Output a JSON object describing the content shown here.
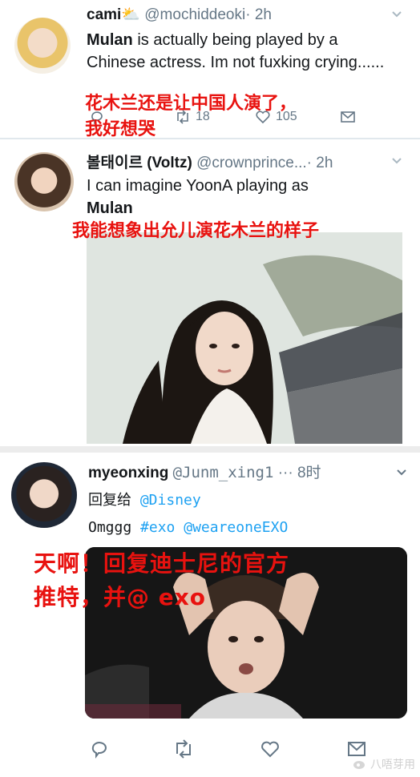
{
  "tweets": [
    {
      "display_name": "cami",
      "handle": "@mochiddeoki",
      "time": "· 2h",
      "text_bold": "Mulan",
      "text_rest": " is actually being played by a Chinese actress. Im not fuxking crying......",
      "retweets": "18",
      "likes": "105",
      "annotation_line1": "花木兰还是让中国人演了，",
      "annotation_line2": "我好想哭"
    },
    {
      "display_name": "볼태이르 (Voltz)",
      "handle": "@crownprince...",
      "time": "· 2h",
      "text_line1": "I can imagine YoonA playing as",
      "text_bold": "Mulan",
      "annotation": "我能想象出允儿演花木兰的样子"
    },
    {
      "display_name": "myeonxing",
      "handle": "@Junm_xing1",
      "more": "···",
      "time": "8时",
      "reply_prefix": "回复给",
      "reply_to": "@Disney",
      "text_start": "Omggg",
      "hashtag": "#exo",
      "mention": "@weareoneEXO",
      "annotation_line1": "天啊！回复迪士尼的官方",
      "annotation_line2": "推特，并@ exo",
      "watermark": "八唔芽用"
    }
  ],
  "colors": {
    "annotation": "#e8120f",
    "link": "#1da1f2",
    "meta": "#657786"
  }
}
